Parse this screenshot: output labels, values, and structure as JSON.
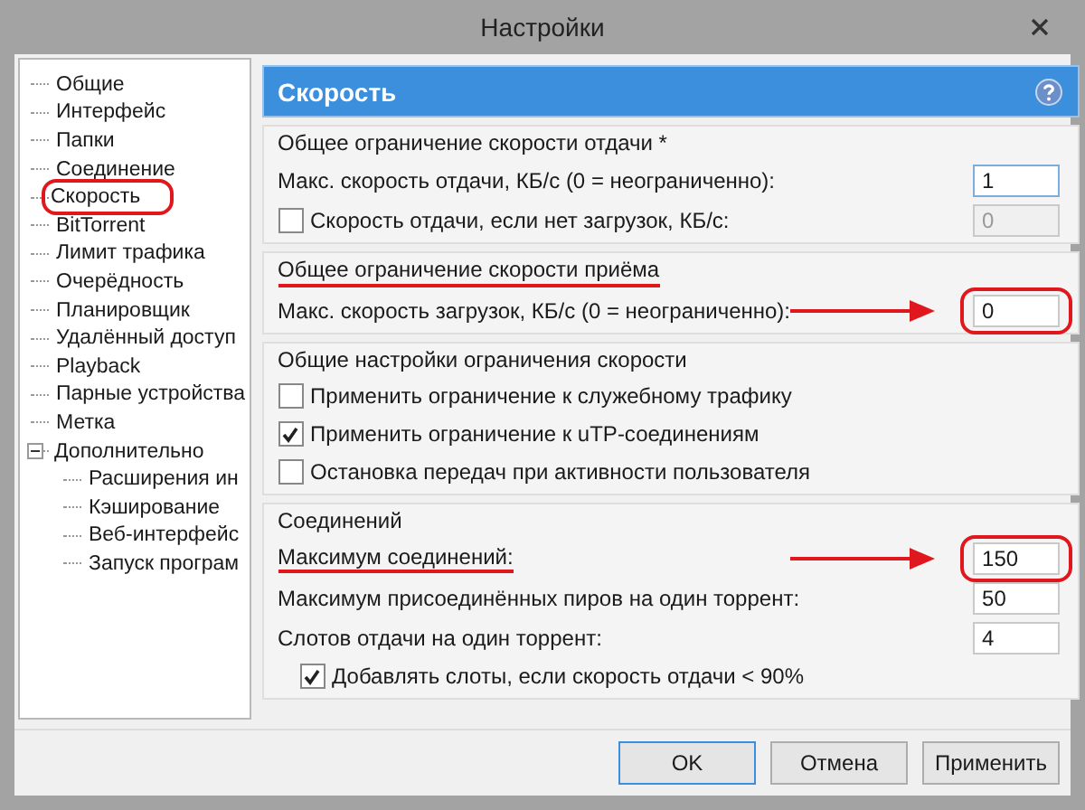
{
  "window": {
    "title": "Настройки"
  },
  "tree": [
    {
      "label": "Общие",
      "circled": false
    },
    {
      "label": "Интерфейс",
      "circled": false
    },
    {
      "label": "Папки",
      "circled": false
    },
    {
      "label": "Соединение",
      "circled": false
    },
    {
      "label": "Скорость",
      "circled": true
    },
    {
      "label": "BitTorrent",
      "circled": false
    },
    {
      "label": "Лимит трафика",
      "circled": false
    },
    {
      "label": "Очерёдность",
      "circled": false
    },
    {
      "label": "Планировщик",
      "circled": false
    },
    {
      "label": "Удалённый доступ",
      "circled": false
    },
    {
      "label": "Playback",
      "circled": false
    },
    {
      "label": "Парные устройства",
      "circled": false
    },
    {
      "label": "Метка",
      "circled": false
    },
    {
      "label": "Дополнительно",
      "circled": false,
      "expanded": true,
      "children": [
        {
          "label": "Расширения ин",
          "circled": false
        },
        {
          "label": "Кэширование",
          "circled": false
        },
        {
          "label": "Веб-интерфейс",
          "circled": false
        },
        {
          "label": "Запуск програм",
          "circled": false
        }
      ]
    }
  ],
  "section": {
    "title": "Скорость"
  },
  "groups": [
    {
      "title": "Общее ограничение скорости отдачи *",
      "underlined": false,
      "rows": [
        {
          "kind": "field",
          "label": "Макс. скорость отдачи, КБ/с (0 = неограниченно):",
          "value": "1",
          "focused": true,
          "disabled": false,
          "underlined": false,
          "arrow": false,
          "circled": false
        },
        {
          "kind": "checkfield",
          "label": "Скорость отдачи, если нет загрузок, КБ/с:",
          "checked": false,
          "value": "0",
          "focused": false,
          "disabled": true,
          "underlined": false,
          "arrow": false,
          "circled": false
        }
      ]
    },
    {
      "title": "Общее ограничение скорости приёма",
      "underlined": true,
      "rows": [
        {
          "kind": "field",
          "label": "Макс. скорость загрузок, КБ/с (0 = неограниченно):",
          "value": "0",
          "focused": false,
          "disabled": false,
          "underlined": false,
          "arrow": true,
          "circled": true
        }
      ]
    },
    {
      "title": "Общие настройки ограничения скорости",
      "underlined": false,
      "rows": [
        {
          "kind": "check",
          "label": "Применить ограничение к служебному трафику",
          "checked": false,
          "indented": false
        },
        {
          "kind": "check",
          "label": "Применить ограничение к uTP-соединениям",
          "checked": true,
          "indented": false
        },
        {
          "kind": "check",
          "label": "Остановка передач при активности пользователя",
          "checked": false,
          "indented": false
        }
      ]
    },
    {
      "title": "Соединений",
      "underlined": false,
      "rows": [
        {
          "kind": "field",
          "label": "Максимум соединений:",
          "value": "150",
          "focused": false,
          "disabled": false,
          "underlined": true,
          "arrow": true,
          "circled": true
        },
        {
          "kind": "field",
          "label": "Максимум присоединённых пиров на один торрент:",
          "value": "50",
          "focused": false,
          "disabled": false,
          "underlined": false,
          "arrow": false,
          "circled": false
        },
        {
          "kind": "field",
          "label": "Слотов отдачи на один торрент:",
          "value": "4",
          "focused": false,
          "disabled": false,
          "underlined": false,
          "arrow": false,
          "circled": false
        },
        {
          "kind": "check",
          "label": "Добавлять слоты, если скорость отдачи < 90%",
          "checked": true,
          "indented": true
        }
      ]
    }
  ],
  "buttons": [
    {
      "label": "OK",
      "default": true
    },
    {
      "label": "Отмена",
      "default": false
    },
    {
      "label": "Применить",
      "default": false
    }
  ]
}
